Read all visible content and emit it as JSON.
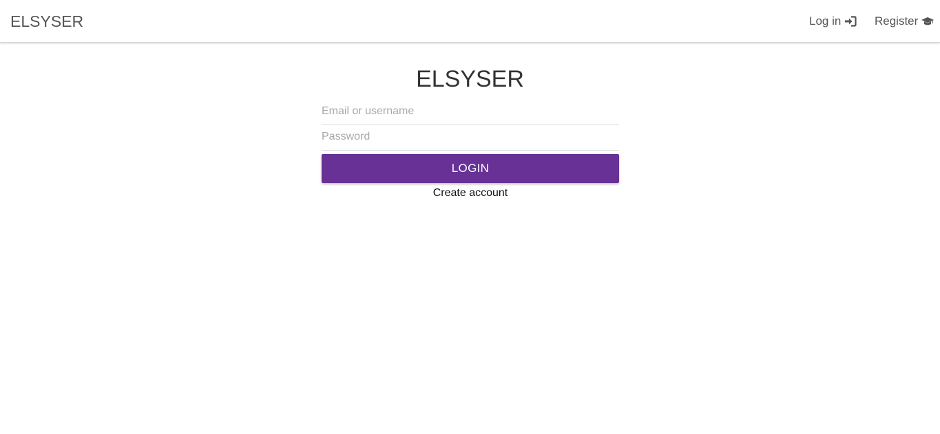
{
  "navbar": {
    "brand": "ELSYSER",
    "login_label": "Log in",
    "login_icon": "sign-in-icon",
    "register_label": "Register",
    "register_icon": "graduation-cap-icon"
  },
  "main": {
    "title": "ELSYSER",
    "username_placeholder": "Email or username",
    "password_placeholder": "Password",
    "login_button": "LOGIN",
    "create_account": "Create account"
  },
  "colors": {
    "accent": "#673195",
    "nav_text": "#555555",
    "title_text": "#333333"
  }
}
